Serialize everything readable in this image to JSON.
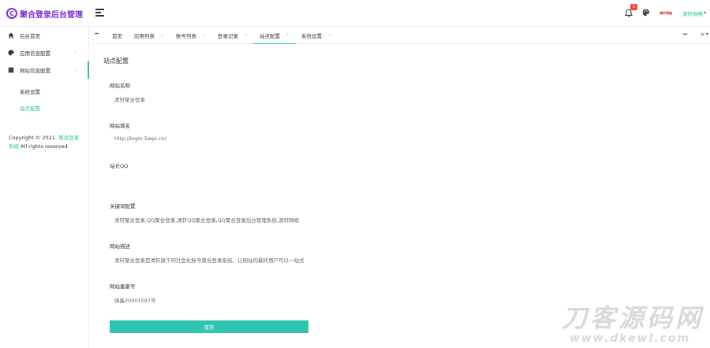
{
  "app": {
    "logo_char": "C",
    "title": "聚合登录后台管理"
  },
  "header": {
    "notification_count": "1",
    "avatar_text": "清轩网络",
    "user_name": "清轩网络",
    "user_caret": "▴"
  },
  "sidebar": {
    "items": [
      {
        "label": "后台首页",
        "arrow": ""
      },
      {
        "label": "应用信息配置",
        "arrow": "‹"
      },
      {
        "label": "网站信息配置",
        "arrow": "⌄"
      }
    ],
    "subitems": [
      {
        "label": "系统设置"
      },
      {
        "label": "站点配置"
      }
    ],
    "copyright": {
      "prefix": "Copyright © 2021. ",
      "link": "聚合登录系统",
      "suffix": " All rights reserved."
    }
  },
  "tabs": {
    "prev": "⏮",
    "next": "⏭",
    "more": "≡ ▾",
    "items": [
      {
        "label": "首页",
        "dot": ""
      },
      {
        "label": "应用列表",
        "dot": "•"
      },
      {
        "label": "账号列表",
        "dot": "•"
      },
      {
        "label": "登录记录",
        "dot": "•"
      },
      {
        "label": "站点配置",
        "dot": "•"
      },
      {
        "label": "系统设置",
        "dot": "•"
      }
    ]
  },
  "main": {
    "title": "站点配置",
    "fields": [
      {
        "label": "网站名称",
        "value": "清轩聚合登录"
      },
      {
        "label": "网站域名",
        "value": "http://login.5aqx.cn/"
      },
      {
        "label": "站长QQ",
        "value": ""
      },
      {
        "label": "关键词配置",
        "value": "清轩聚合登录,QQ聚合登录,清轩QQ聚合登录,QQ聚合登录后台管理系统,清轩网络"
      },
      {
        "label": "网站描述",
        "value": "清轩聚合登录是清轩旗下的社会化账号聚合登录系统，让网站的最终用户可以一站式"
      },
      {
        "label": "网站备案号",
        "value": "晓备20001587号"
      }
    ],
    "save_label": "保存"
  },
  "watermark": {
    "big": "刀客源码网",
    "small": "www.dkewl.com"
  },
  "colors": {
    "accent": "#2ac0a4",
    "brand": "#7a2fd6",
    "button": "#2ec4b0",
    "badge": "#e84a3c"
  }
}
